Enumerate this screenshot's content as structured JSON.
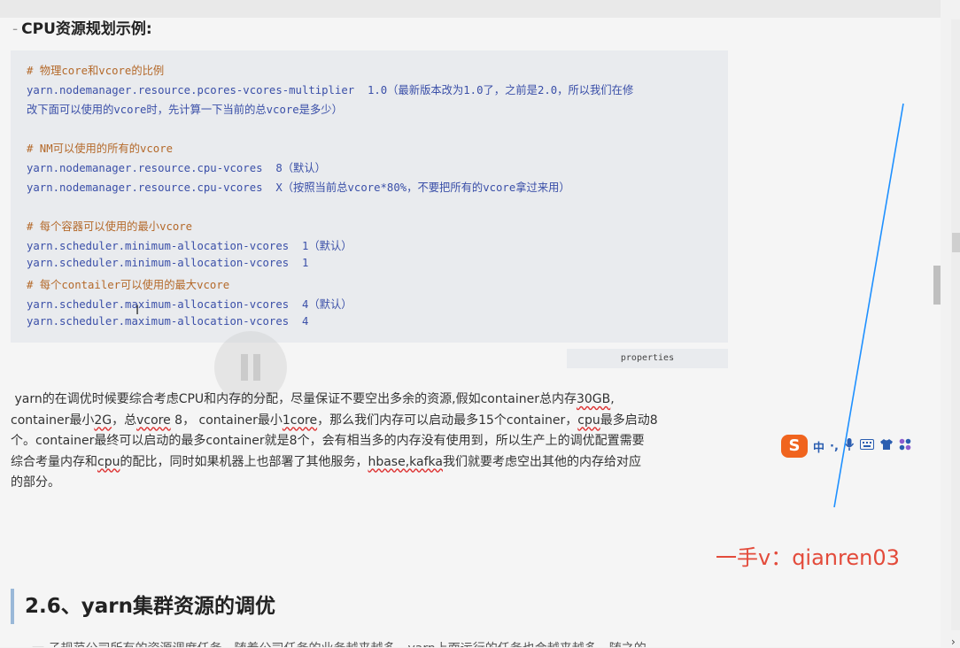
{
  "heading_small": "CPU资源规划示例:",
  "code": {
    "lines": [
      {
        "text": "# 物理core和vcore的比例",
        "comment": true
      },
      {
        "text": "yarn.nodemanager.resource.pcores-vcores-multiplier  1.0（最新版本改为1.0了，之前是2.0，所以我们在修",
        "comment": false
      },
      {
        "text": "改下面可以使用的vcore时，先计算一下当前的总vcore是多少）",
        "comment": false
      },
      {
        "text": "",
        "comment": false
      },
      {
        "text": "# NM可以使用的所有的vcore",
        "comment": true
      },
      {
        "text": "yarn.nodemanager.resource.cpu-vcores  8（默认）",
        "comment": false
      },
      {
        "text": "yarn.nodemanager.resource.cpu-vcores  X（按照当前总vcore*80%，不要把所有的vcore拿过来用）",
        "comment": false
      },
      {
        "text": "",
        "comment": false
      },
      {
        "text": "# 每个容器可以使用的最小vcore",
        "comment": true
      },
      {
        "text": "yarn.scheduler.minimum-allocation-vcores  1（默认）",
        "comment": false
      },
      {
        "text": "yarn.scheduler.minimum-allocation-vcores  1",
        "comment": false
      },
      {
        "text": "# 每个contailer可以使用的最大vcore",
        "comment": true
      },
      {
        "text": "yarn.scheduler.maximum-allocation-vcores  4（默认）",
        "comment": false
      },
      {
        "text": "yarn.scheduler.maximum-allocation-vcores  4",
        "comment": false
      }
    ],
    "language": "properties"
  },
  "paragraph": {
    "l1a": "yarn的在调优时候要综合考虑CPU和内存的分配，尽量保证不要空出多余的资源,假如container总内存",
    "l1b": "30GB",
    "l1c": ",",
    "l2a": "container最小",
    "l2b": "2G",
    "l2c": "，总",
    "l2d": "vcore",
    "l2e": " 8，  container最小",
    "l2f": "1core",
    "l2g": "，那么我们内存可以启动最多15个container，",
    "l2h": "cpu",
    "l2i": "最多启动8",
    "l3": "个。container最终可以启动的最多container就是8个，会有相当多的内存没有使用到，所以生产上的调优配置需要",
    "l4a": "综合考量内存和",
    "l4b": "cpu",
    "l4c": "的配比，同时如果机器上也部署了其他服务，",
    "l4d": "hbase,kafka",
    "l4e": "我们就要考虑空出其他的内存给对应",
    "l5": "的部分。"
  },
  "section_heading": "2.6、yarn集群资源的调优",
  "cutoff_text": "一 子规范公司所有的资源调度任务，随着公司任务的业务越来越多，yarn上面运行的任务也会越来越多，随之的",
  "ime_toolbar": {
    "logo": "S",
    "mode": "中",
    "items": [
      "·,",
      "mic-icon",
      "keyboard-icon",
      "shirt-icon",
      "grid-icon"
    ]
  },
  "watermark": "一手v：qianren03",
  "colors": {
    "comment": "#b4692a",
    "code": "#3a4fa8",
    "watermark": "#e34b3b",
    "pen": "#1e90ff",
    "ime": "#f0641e"
  }
}
